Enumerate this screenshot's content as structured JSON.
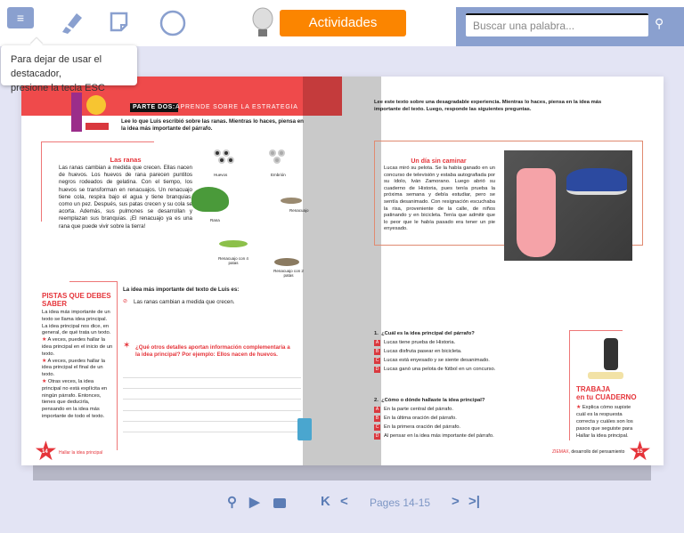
{
  "toolbar": {
    "menu_icon": "≡",
    "activities_label": "Actividades",
    "search_placeholder": "Buscar una palabra..."
  },
  "tooltip": {
    "line1": "Para dejar de usar el destacador,",
    "line2": "presione la tecla ESC"
  },
  "left_page": {
    "header_label": "PARTE DOS:",
    "header_title": "APRENDE SOBRE LA ESTRATEGIA",
    "intro": "Lee lo que Luis escribió sobre las ranas. Mientras lo haces, piensa en la idea más importante del párrafo.",
    "story_title": "Las ranas",
    "story_text": "Las ranas cambian a medida que crecen. Ellas nacen de huevos. Los huevos de rana parecen puntitos negros rodeados de gelatina. Con el tiempo, los huevos se transforman en renacuajos. Un renacuajo tiene cola, respira bajo el agua y tiene branquias, como un pez. Después, sus patas crecen y su cola se acorta. Además, sus pulmones se desarrollan y reemplazan sus branquias. ¡El renacuajo ya es una rana que puede vivir sobre la tierra!",
    "cycle_labels": [
      "Huevos",
      "Embrión",
      "Renacuajo",
      "Renacuajo con 2 patas",
      "Renacuajo con 4 patas",
      "Rana"
    ],
    "tips_title": "PISTAS QUE DEBES SABER",
    "tips_intro": "La idea más importante de un texto se llama idea principal. La idea principal nos dice, en general, de qué trata un texto.",
    "tips": [
      "A veces, puedes hallar la idea principal en el inicio de un texto.",
      "A veces, puedes hallar la idea principal el final de un texto.",
      "Otras veces, la idea principal no está explícita en ningún párrafo. Entonces, tienes que deducirla, pensando en la idea más importante de todo el texto."
    ],
    "main_idea_label": "La idea más importante del texto de Luis es:",
    "main_idea_answer": "Las ranas cambian a medida que crecen.",
    "question": "¿Qué otros detalles aportan información complementaria a la idea principal? Por ejemplo: Ellos nacen de huevos.",
    "page_number": "14",
    "footer": "Hallar la idea principal"
  },
  "right_page": {
    "intro": "Lee este texto sobre una desagradable experiencia.  Mientras lo haces, piensa en la idea más importante del texto. Luego, responde las siguientes preguntas.",
    "story_title": "Un día sin caminar",
    "story_text": "Lucas miró su pelota. Se la había ganado en un concurso de televisión y estaba autografiada por su ídolo, Iván Zamorano. Luego abrió su cuaderno de Historia, pues tenía prueba la próxima semana y debía estudiar, pero se sentía desanimado. Con resignación escuchaba la risa, proveniente de la calle, de niños patinando y en bicicleta. Tenía que admitir que lo peor que le había pasado era tener un pie enyesado.",
    "questions": [
      {
        "num": "1.",
        "text": "¿Cuál es la idea principal del párrafo?",
        "options": [
          {
            "l": "A",
            "t": "Lucas tiene prueba de Historia."
          },
          {
            "l": "B",
            "t": "Lucas disfruta pasear en bicicleta."
          },
          {
            "l": "C",
            "t": "Lucas está enyesado y se siente desanimado."
          },
          {
            "l": "D",
            "t": "Lucas ganó una pelota de fútbol en un concurso."
          }
        ]
      },
      {
        "num": "2.",
        "text": "¿Cómo o dónde hallaste la idea principal?",
        "options": [
          {
            "l": "A",
            "t": "En la parte central del párrafo."
          },
          {
            "l": "B",
            "t": "En la última oración del párrafo."
          },
          {
            "l": "C",
            "t": "En la primera oración del párrafo."
          },
          {
            "l": "D",
            "t": "Al pensar en la idea más importante del párrafo."
          }
        ]
      }
    ],
    "work_title1": "TRABAJA",
    "work_title2": "en tu CUADERNO",
    "work_text": "Explica cómo supiste cuál es la respuesta correcta y cuáles son los pasos que seguiste para Hallar la idea principal.",
    "footer_brand": "ZIEMAX,",
    "footer": "desarrollo del pensamiento",
    "page_number": "15"
  },
  "pager": {
    "label": "Pages 14-15"
  },
  "colors": {
    "accent": "#fb8500",
    "brand": "#8aa0cf",
    "red": "#e5343a"
  }
}
